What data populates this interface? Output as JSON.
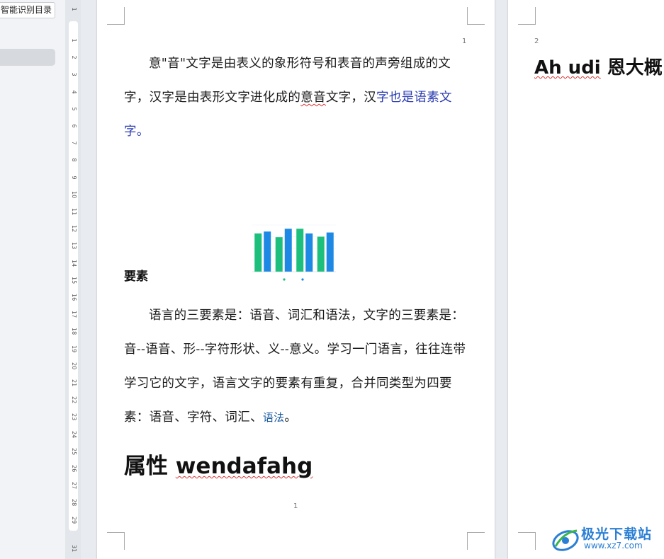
{
  "nav_pane": {
    "toc_button_label": "智能识别目录"
  },
  "ruler": {
    "numbers": [
      "1",
      "1",
      "2",
      "3",
      "4",
      "5",
      "6",
      "7",
      "8",
      "9",
      "10",
      "11",
      "12",
      "13",
      "14",
      "15",
      "16",
      "17",
      "18",
      "19",
      "20",
      "21",
      "22",
      "23",
      "24",
      "25",
      "26",
      "27",
      "28",
      "29",
      "31"
    ]
  },
  "page1": {
    "header_page_number": "1",
    "paragraph1": {
      "part1": "意\"音\"文字是由表义的象形符号和表音的声旁组成的文字，汉字是由表形文字进化成的",
      "part2_underlined": "意音",
      "part3": "文字，汉",
      "part4_blue": "字也是语素文字",
      "part5": "。"
    },
    "section_heading": "要素",
    "paragraph2": {
      "part1": "语言的三要素是：语音、词汇和语法，文字的三要素是：音--语音、形--字符形状、义--意义。学习一门语言，往往连带学习它的文字，语言文字的要素有重复，合并同类型为四要素：语音、字符、词汇、",
      "part2_link": "语法",
      "part3": "。"
    },
    "heading_attr": {
      "zh": "属性 ",
      "en_underlined": "wendafahg"
    },
    "footer_page_number": "1"
  },
  "page2": {
    "header_page_number": "2",
    "heading": {
      "part1_underlined": "Ah udi",
      "part2": " 恩大概"
    }
  },
  "chart_data": {
    "type": "bar",
    "categories": [
      "",
      "",
      "",
      ""
    ],
    "series": [
      {
        "values": [
          0.82,
          0.74,
          0.92,
          0.75
        ]
      },
      {
        "values": [
          0.86,
          0.92,
          0.82,
          0.84
        ]
      }
    ],
    "ylim": [
      0,
      1
    ],
    "grid": true,
    "legend": "bottom",
    "colors": [
      "#1dbf7d",
      "#1e88e5"
    ]
  },
  "watermark": {
    "name": "极光下载站",
    "url": "www.xz7.com"
  },
  "colors": {
    "page_bg": "#e8ebf0",
    "blue_text": "#2a3bb0",
    "logo_blue": "#2b7fd4"
  }
}
